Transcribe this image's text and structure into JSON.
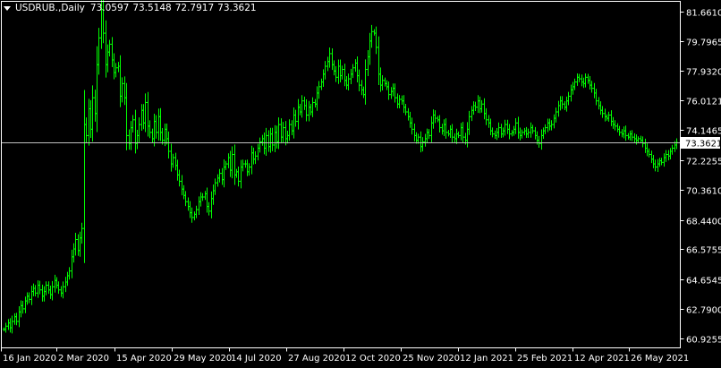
{
  "header": {
    "symbol": "USDRUB.",
    "separator": ",",
    "timeframe": "Daily",
    "open": "73.0597",
    "high": "73.5148",
    "low": "72.7917",
    "close": "73.3621"
  },
  "colors": {
    "background": "#000000",
    "bars": "#00ff00",
    "frame": "#ffffff",
    "price_line": "#c0c0c0",
    "price_label_bg": "#ffffff",
    "price_label_text": "#000000"
  },
  "icons": {
    "dropdown": "triangle-down-icon"
  },
  "chart_data": {
    "type": "ohlc",
    "title": "USDRUB.,Daily",
    "current_price": 73.3621,
    "ylim": [
      60.35,
      82.35
    ],
    "y_ticks": [
      81.661,
      79.7965,
      77.932,
      76.0121,
      74.1465,
      72.2255,
      70.361,
      68.44,
      66.5755,
      64.6545,
      62.79,
      60.9255
    ],
    "y_tick_labels": [
      "81.6610",
      "79.7965",
      "77.9320",
      "76.0121",
      "74.1465",
      "72.2255",
      "70.3610",
      "68.4400",
      "66.5755",
      "64.6545",
      "62.7900",
      "60.9255"
    ],
    "x_tick_labels": [
      "16 Jan 2020",
      "2 Mar 2020",
      "15 Apr 2020",
      "29 May 2020",
      "14 Jul 2020",
      "27 Aug 2020",
      "12 Oct 2020",
      "25 Nov 2020",
      "12 Jan 2021",
      "25 Feb 2021",
      "12 Apr 2021",
      "26 May 2021"
    ],
    "series": [
      {
        "values": [
          61.5,
          61.7,
          61.9,
          61.6,
          62.0,
          62.3,
          62.0,
          62.6,
          63.0,
          62.8,
          63.3,
          63.6,
          63.4,
          63.9,
          64.1,
          63.8,
          64.3,
          64.0,
          63.6,
          63.9,
          64.3,
          64.0,
          63.7,
          64.2,
          64.6,
          64.3,
          64.0,
          63.8,
          64.2,
          64.5,
          64.9,
          65.2,
          66.1,
          66.6,
          67.2,
          66.5,
          67.3,
          67.9,
          74.5,
          73.8,
          75.5,
          74.2,
          76.2,
          75.2,
          78.3,
          80.0,
          81.8,
          80.3,
          78.3,
          79.1,
          79.6,
          78.6,
          77.8,
          78.1,
          78.2,
          76.3,
          77.1,
          76.2,
          73.8,
          73.3,
          74.3,
          74.8,
          73.3,
          73.8,
          74.5,
          75.4,
          74.6,
          75.9,
          74.4,
          74.0,
          73.6,
          74.7,
          74.0,
          75.0,
          74.0,
          73.5,
          74.2,
          73.6,
          72.8,
          72.0,
          72.4,
          71.9,
          71.3,
          70.9,
          70.4,
          70.0,
          69.6,
          69.3,
          68.9,
          68.6,
          68.8,
          69.1,
          69.6,
          69.9,
          69.9,
          70.1,
          69.3,
          69.0,
          69.8,
          70.3,
          70.8,
          71.1,
          71.4,
          71.0,
          71.8,
          72.0,
          72.4,
          71.6,
          72.6,
          71.3,
          71.5,
          70.9,
          71.8,
          72.0,
          72.0,
          71.5,
          71.8,
          72.7,
          72.3,
          72.5,
          73.0,
          73.4,
          73.6,
          73.0,
          73.8,
          73.1,
          73.9,
          73.2,
          74.0,
          73.4,
          74.5,
          73.7,
          74.3,
          73.6,
          73.8,
          74.5,
          74.1,
          75.1,
          74.7,
          75.6,
          75.3,
          76.0,
          75.7,
          75.1,
          75.6,
          75.3,
          75.9,
          75.8,
          76.5,
          76.9,
          77.2,
          77.7,
          78.2,
          78.5,
          79.0,
          78.3,
          77.9,
          77.5,
          78.2,
          77.6,
          78.0,
          77.3,
          77.0,
          77.4,
          77.7,
          78.1,
          78.4,
          77.6,
          77.0,
          76.7,
          76.4,
          78.0,
          78.8,
          79.8,
          80.4,
          80.3,
          79.4,
          77.7,
          77.0,
          77.3,
          77.1,
          76.9,
          76.4,
          76.6,
          76.8,
          76.2,
          75.8,
          76.1,
          76.0,
          75.6,
          75.3,
          75.0,
          74.6,
          74.2,
          73.8,
          73.5,
          73.7,
          73.1,
          73.4,
          73.6,
          74.0,
          73.8,
          74.6,
          75.1,
          74.9,
          74.8,
          74.3,
          74.1,
          74.5,
          74.0,
          73.9,
          74.2,
          73.7,
          73.6,
          73.9,
          73.8,
          74.3,
          73.7,
          73.5,
          74.2,
          75.0,
          75.4,
          75.7,
          75.6,
          76.0,
          75.5,
          75.8,
          75.2,
          74.8,
          74.6,
          74.1,
          73.9,
          73.8,
          74.0,
          74.3,
          73.9,
          74.1,
          74.5,
          74.2,
          73.9,
          74.0,
          74.2,
          74.6,
          74.0,
          73.8,
          74.0,
          74.1,
          73.9,
          74.0,
          74.3,
          74.1,
          73.8,
          73.5,
          73.3,
          73.8,
          74.1,
          74.3,
          74.6,
          74.4,
          74.5,
          74.9,
          75.3,
          75.7,
          76.0,
          75.8,
          75.6,
          76.0,
          76.3,
          76.7,
          76.9,
          77.2,
          77.5,
          77.4,
          77.2,
          77.1,
          77.5,
          77.3,
          77.0,
          76.8,
          76.5,
          76.0,
          75.7,
          75.4,
          75.2,
          75.0,
          74.9,
          75.1,
          74.7,
          74.5,
          74.4,
          74.2,
          74.0,
          73.9,
          74.1,
          73.8,
          73.7,
          73.9,
          73.7,
          73.6,
          73.5,
          73.6,
          73.5,
          73.3,
          73.0,
          72.8,
          72.6,
          72.3,
          72.0,
          71.8,
          72.0,
          72.2,
          72.1,
          72.4,
          72.6,
          72.5,
          72.8,
          73.0,
          73.2,
          73.36
        ]
      }
    ]
  }
}
